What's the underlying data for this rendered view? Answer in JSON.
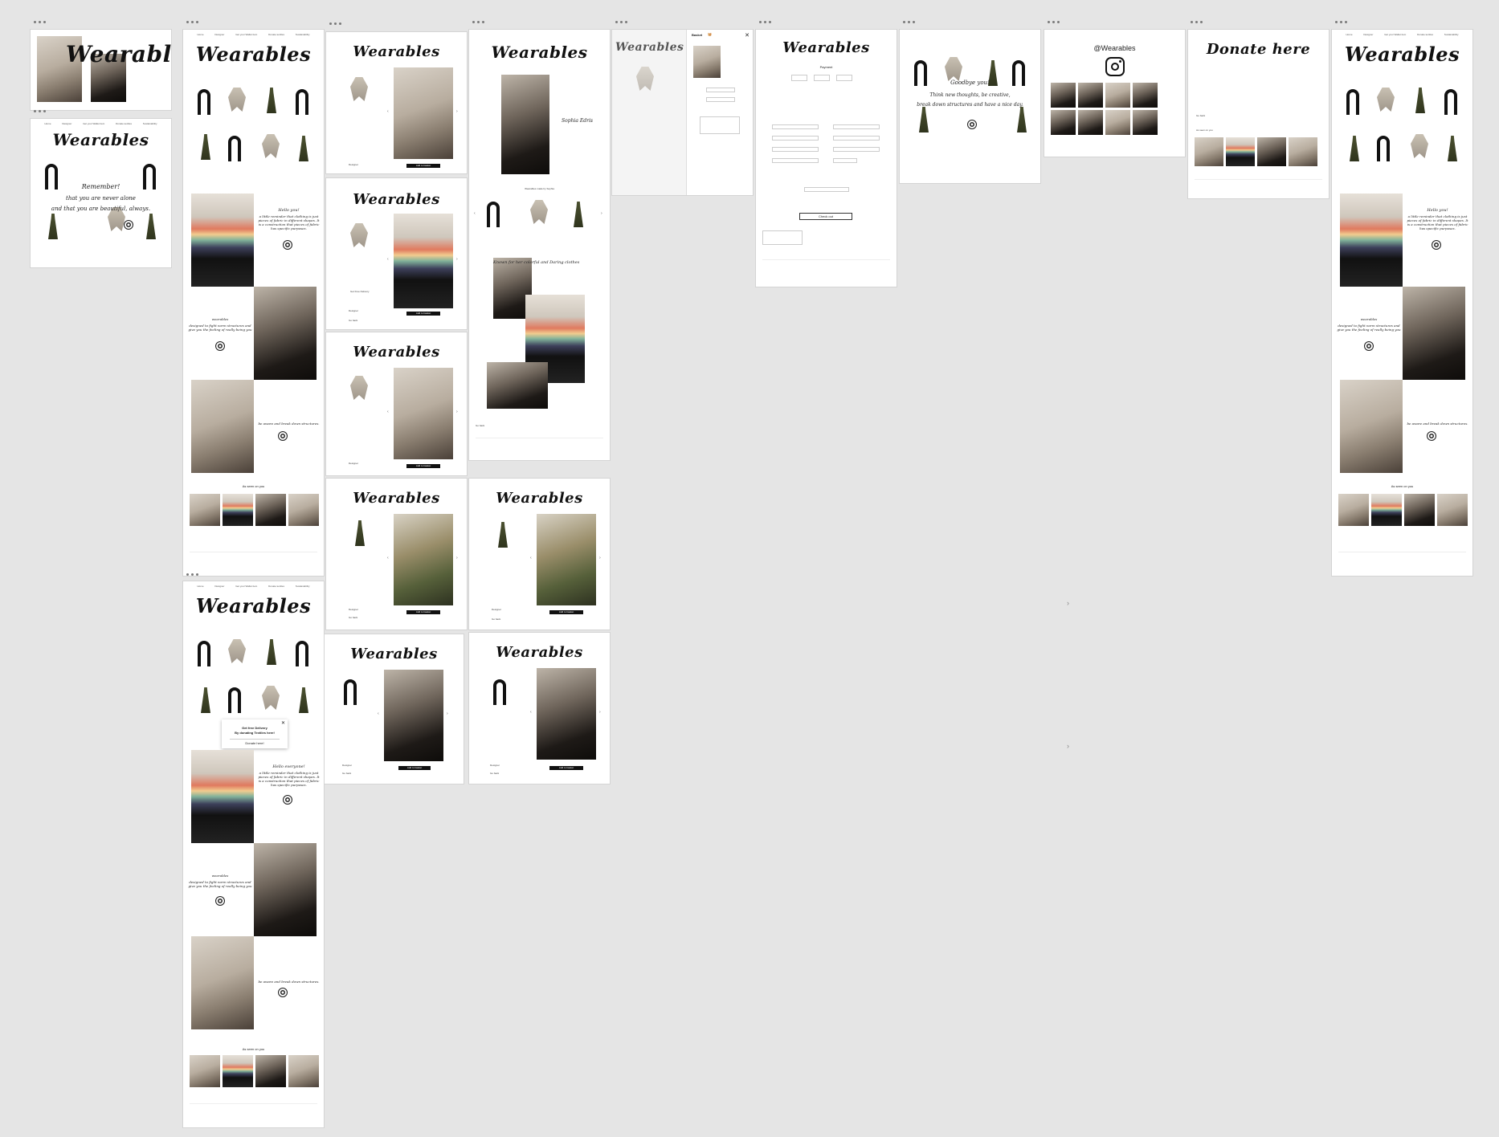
{
  "brand": {
    "name": "Wearables",
    "donate_title": "Donate here",
    "instagram_handle": "@Wearables"
  },
  "nav": {
    "items": [
      "Home",
      "Designer",
      "Get your Wallet item",
      "Donate textiles",
      "Sustainability"
    ]
  },
  "home": {
    "hello": "Hello you!",
    "hello_body": "a little reminder that clothing is just pieces of fabric in different shapes. It is a construction that pieces of fabric has specific purposes.",
    "hello_everyone": "Hello everyone!",
    "wearables_body": "designed to fight norm structures and give you the feeling of really being you",
    "wearables_label": "wearables",
    "break_norms": "be aware and break down structures.",
    "seen_on_you": "As seen on you"
  },
  "intro": {
    "remember": "Remember!",
    "line2": "that you are never alone",
    "line3": "and that you are beautiful, always."
  },
  "product": {
    "add_to_basket": "Add to basket",
    "designer": "Designer",
    "go_back": "Go back",
    "free_delivery": "Get Free Delivery"
  },
  "designer": {
    "caption": "Sophia Edris",
    "handmade": "Wearables made by Sophia",
    "known_for": "Known for her colorful and Daring clothes"
  },
  "basket": {
    "title": "Basket"
  },
  "checkout": {
    "payment": "Payment",
    "checkout_button": "Check out"
  },
  "goodbye": {
    "line1": "Goodbye you!",
    "line2": "Think new thoughts, be creative,",
    "line3": "break down structures and have a nice day."
  },
  "popup": {
    "line1": "Get free Delivery",
    "line2": "By donating Textiles here!",
    "button": "Donate here!"
  },
  "donate": {
    "back": "Go back",
    "seen_on_you": "As seen on you"
  },
  "icons": [
    "instagram-icon",
    "close-icon",
    "spiral-icon",
    "arrow-left-icon",
    "arrow-right-icon",
    "basket-icon",
    "chevron-right-icon"
  ]
}
